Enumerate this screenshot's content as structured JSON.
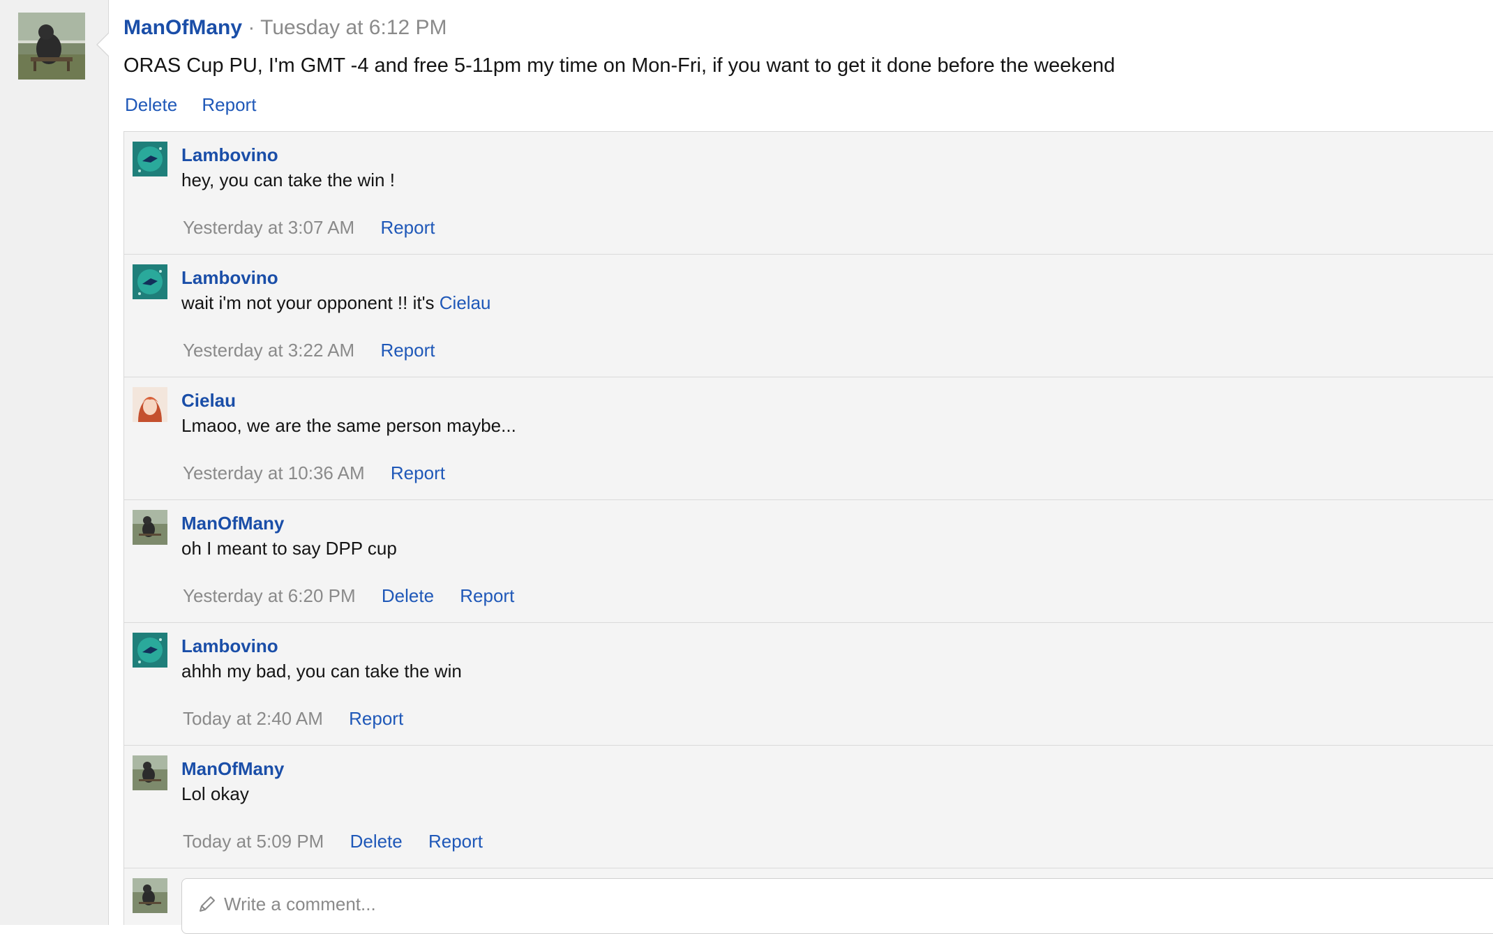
{
  "post": {
    "author": "ManOfMany",
    "separator": "·",
    "time": "Tuesday at 6:12 PM",
    "body": "ORAS Cup PU, I'm GMT -4 and free 5-11pm my time on Mon-Fri, if you want to get it done before the weekend",
    "actions": {
      "delete": "Delete",
      "report": "Report"
    }
  },
  "comments": [
    {
      "author": "Lambovino",
      "text": "hey, you can take the win !",
      "time": "Yesterday at 3:07 AM",
      "report": "Report"
    },
    {
      "author": "Lambovino",
      "text": "wait i'm not your opponent !! it's ",
      "mention": "Cielau",
      "time": "Yesterday at 3:22 AM",
      "report": "Report"
    },
    {
      "author": "Cielau",
      "text": "Lmaoo, we are the same person maybe...",
      "time": "Yesterday at 10:36 AM",
      "report": "Report"
    },
    {
      "author": "ManOfMany",
      "text": "oh I meant to say DPP cup",
      "time": "Yesterday at 6:20 PM",
      "delete": "Delete",
      "report": "Report"
    },
    {
      "author": "Lambovino",
      "text": "ahhh my bad, you can take the win",
      "time": "Today at 2:40 AM",
      "report": "Report"
    },
    {
      "author": "ManOfMany",
      "text": "Lol okay",
      "time": "Today at 5:09 PM",
      "delete": "Delete",
      "report": "Report"
    }
  ],
  "new_comment": {
    "placeholder": "Write a comment..."
  },
  "colors": {
    "link": "#1f58b8",
    "author": "#1a4ea8",
    "muted": "#8a8a8a",
    "thread_bg": "#f4f4f4"
  },
  "icons": {
    "pencil": "pencil-icon"
  }
}
